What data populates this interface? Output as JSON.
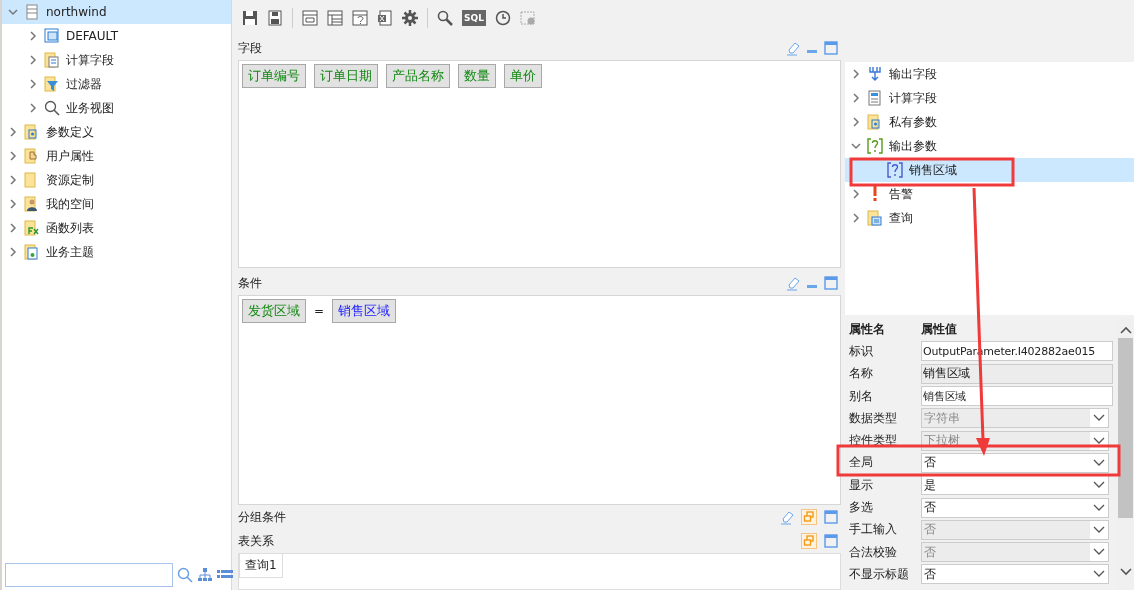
{
  "sidebar": {
    "tree": [
      {
        "label": "northwind",
        "expanded": true,
        "selected": true,
        "children": [
          {
            "label": "DEFAULT",
            "expanded": false,
            "selected": false
          },
          {
            "label": "计算字段",
            "expanded": false,
            "selected": false
          },
          {
            "label": "过滤器",
            "expanded": false,
            "selected": false
          },
          {
            "label": "业务视图",
            "expanded": false,
            "selected": false
          }
        ]
      },
      {
        "label": "参数定义",
        "expanded": false,
        "selected": false
      },
      {
        "label": "用户属性",
        "expanded": false,
        "selected": false
      },
      {
        "label": "资源定制",
        "expanded": false,
        "selected": false
      },
      {
        "label": "我的空间",
        "expanded": false,
        "selected": false
      },
      {
        "label": "函数列表",
        "expanded": false,
        "selected": false
      },
      {
        "label": "业务主题",
        "expanded": false,
        "selected": false
      }
    ]
  },
  "toolbar": {
    "sql_label": "SQL"
  },
  "fields_panel": {
    "title": "字段",
    "chips": [
      {
        "label": "订单编号",
        "kind": "field"
      },
      {
        "label": "订单日期",
        "kind": "field"
      },
      {
        "label": "产品名称",
        "kind": "field"
      },
      {
        "label": "数量",
        "kind": "field"
      },
      {
        "label": "单价",
        "kind": "field"
      }
    ]
  },
  "condition_panel": {
    "title": "条件",
    "left": {
      "label": "发货区域",
      "kind": "field"
    },
    "operator": "=",
    "right": {
      "label": "销售区域",
      "kind": "parameter"
    }
  },
  "group_panel": {
    "title": "分组条件"
  },
  "relation_panel": {
    "title": "表关系",
    "tabs": [
      {
        "label": "查询1",
        "selected": true
      }
    ]
  },
  "resource_tree": [
    {
      "label": "输出字段",
      "expanded": false,
      "selected": false
    },
    {
      "label": "计算字段",
      "expanded": false,
      "selected": false
    },
    {
      "label": "私有参数",
      "expanded": false,
      "selected": false
    },
    {
      "label": "输出参数",
      "expanded": true,
      "selected": false,
      "children": [
        {
          "label": "销售区域",
          "selected": true
        }
      ]
    },
    {
      "label": "告警",
      "expanded": false,
      "selected": false
    },
    {
      "label": "查询",
      "expanded": false,
      "selected": false
    }
  ],
  "properties": {
    "header": {
      "name": "属性名",
      "value": "属性值"
    },
    "rows": [
      {
        "label": "标识",
        "value": "OutputParameter.I402882ae015",
        "kind": "text",
        "disabled": false
      },
      {
        "label": "名称",
        "value": "销售区域",
        "kind": "text",
        "disabled": true
      },
      {
        "label": "别名",
        "value": "销售区域",
        "kind": "text",
        "disabled": false
      },
      {
        "label": "数据类型",
        "value": "字符串",
        "kind": "select",
        "disabled": true
      },
      {
        "label": "控件类型",
        "value": "下拉树",
        "kind": "select",
        "disabled": true
      },
      {
        "label": "全局",
        "value": "否",
        "kind": "select",
        "disabled": false
      },
      {
        "label": "显示",
        "value": "是",
        "kind": "select",
        "disabled": false
      },
      {
        "label": "多选",
        "value": "否",
        "kind": "select",
        "disabled": false
      },
      {
        "label": "手工输入",
        "value": "否",
        "kind": "select",
        "disabled": true
      },
      {
        "label": "合法校验",
        "value": "否",
        "kind": "select",
        "disabled": true
      },
      {
        "label": "不显示标题",
        "value": "否",
        "kind": "select",
        "disabled": false
      }
    ]
  }
}
